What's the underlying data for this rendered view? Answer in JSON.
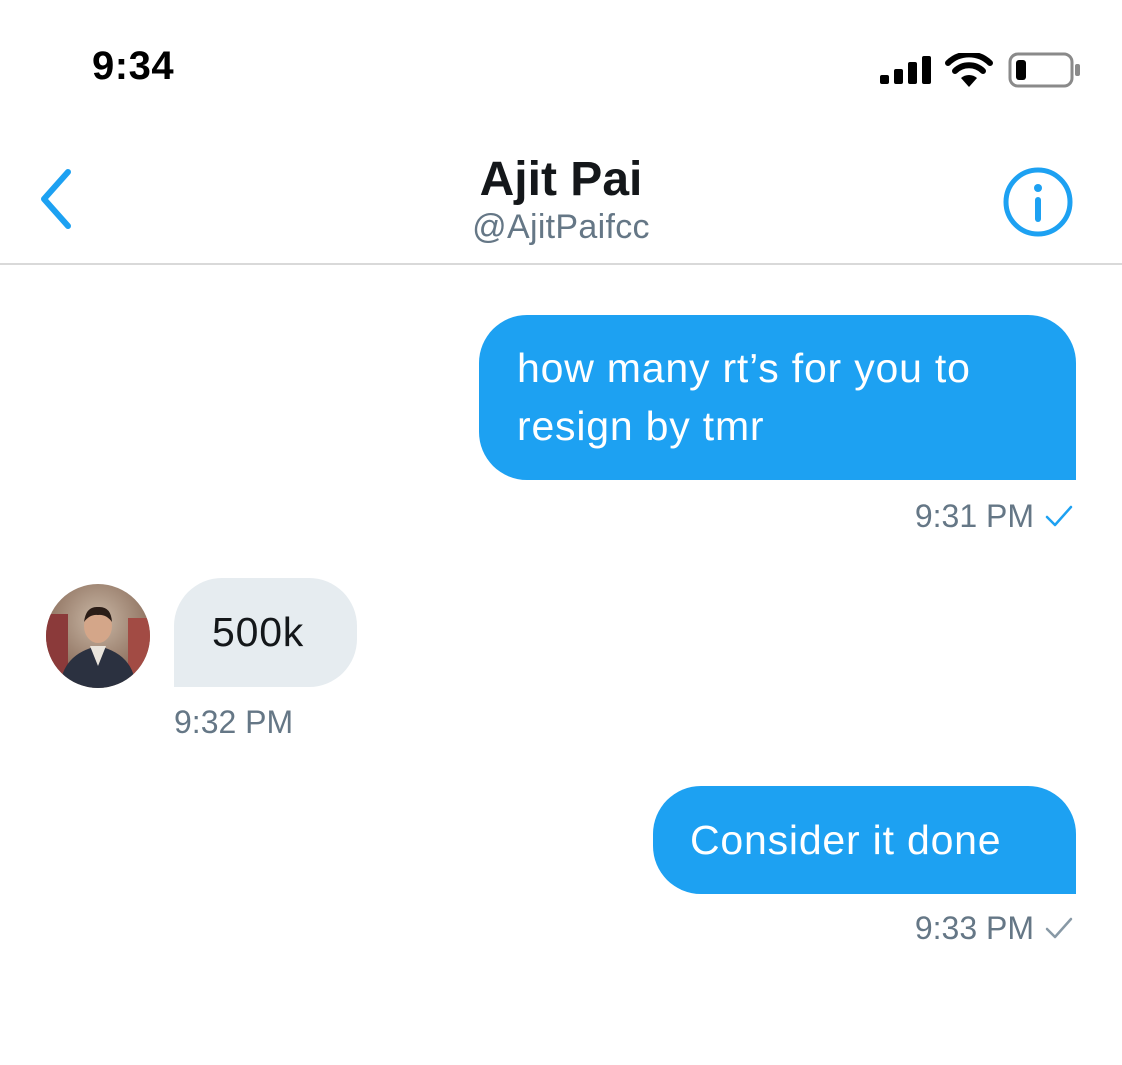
{
  "status_bar": {
    "time": "9:34",
    "signal_icon": "cellular-signal-icon",
    "wifi_icon": "wifi-icon",
    "battery_icon": "battery-icon",
    "battery_level": 0.2
  },
  "header": {
    "back_icon": "chevron-left-icon",
    "title": "Ajit Pai",
    "handle": "@AjitPaifcc",
    "info_icon": "info-circle-icon"
  },
  "messages": [
    {
      "direction": "sent",
      "text": "how many rt’s for you to resign by tmr",
      "time": "9:31 PM",
      "status_icon": "checkmark-icon",
      "status_color": "#1da1f2"
    },
    {
      "direction": "received",
      "text": "500k",
      "time": "9:32 PM",
      "avatar_icon": "user-avatar"
    },
    {
      "direction": "sent",
      "text": "Consider it done",
      "time": "9:33 PM",
      "status_icon": "checkmark-icon",
      "status_color": "#8899a6"
    }
  ],
  "colors": {
    "accent": "#1da1f2",
    "received_bubble": "#e6ecf0",
    "secondary_text": "#657786",
    "primary_text": "#14171a"
  }
}
